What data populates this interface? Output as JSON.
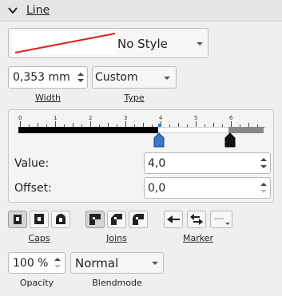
{
  "section": {
    "title": "Line",
    "icon": "chevron-down-icon"
  },
  "line_style": {
    "value": "No Style",
    "preview_color": "#e02020"
  },
  "width": {
    "value": "0,353 mm",
    "label": "Width"
  },
  "type": {
    "value": "Custom",
    "label": "Type"
  },
  "ruler": {
    "numbers": [
      "0",
      "1",
      "2",
      "3",
      "4",
      "5",
      "6"
    ]
  },
  "value_row": {
    "label": "Value:",
    "value": "4,0"
  },
  "offset_row": {
    "label": "Offset:",
    "value": "0,0"
  },
  "caps": {
    "label": "Caps",
    "buttons": [
      "flat-cap",
      "square-cap",
      "round-cap"
    ]
  },
  "joins": {
    "label": "Joins",
    "buttons": [
      "miter-join",
      "bevel-join",
      "round-join"
    ]
  },
  "marker": {
    "label": "Marker"
  },
  "opacity": {
    "value": "100 %",
    "label": "Opacity"
  },
  "blendmode": {
    "value": "Normal",
    "label": "Blendmode"
  },
  "colors": {
    "accent": "#3a78c8",
    "dash_fill": "#000000",
    "gap_fill": "#888888"
  }
}
